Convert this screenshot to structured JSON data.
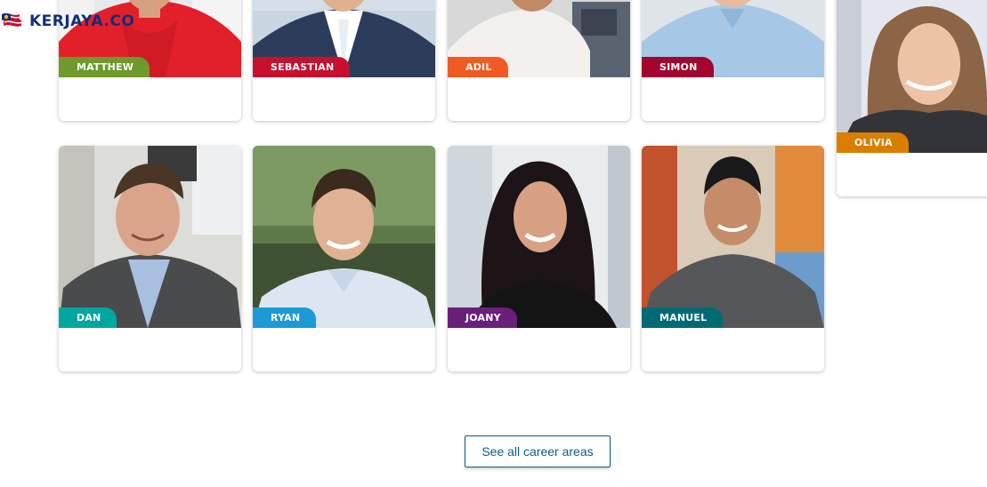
{
  "brand": {
    "name": "KERJAYA.CO"
  },
  "profiles": [
    {
      "name": "MATTHEW",
      "color": "#6d9a2a"
    },
    {
      "name": "SEBASTIAN",
      "color": "#c8102e"
    },
    {
      "name": "ADIL",
      "color": "#f15a22"
    },
    {
      "name": "SIMON",
      "color": "#a1062f"
    },
    {
      "name": "OLIVIA",
      "color": "#d97e00"
    },
    {
      "name": "DAN",
      "color": "#00a7a0"
    },
    {
      "name": "RYAN",
      "color": "#1b9ad6"
    },
    {
      "name": "JOANY",
      "color": "#6a1f7a"
    },
    {
      "name": "MANUEL",
      "color": "#006b75"
    }
  ],
  "cta": {
    "see_all_label": "See all career areas"
  }
}
